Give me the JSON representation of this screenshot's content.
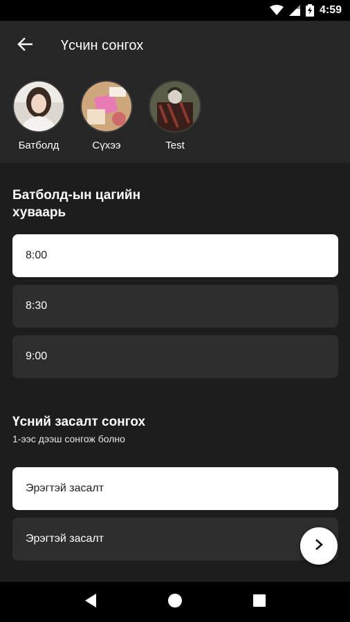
{
  "status_bar": {
    "time": "4:59",
    "icons": [
      "wifi-icon",
      "cellular-signal-icon",
      "battery-icon"
    ]
  },
  "app_bar": {
    "back_icon": "arrow-left-icon",
    "title": "Үсчин сонгох"
  },
  "stylists": [
    {
      "name": "Батболд"
    },
    {
      "name": "Сүхээ"
    },
    {
      "name": "Test"
    }
  ],
  "schedule": {
    "title_line1": "Батболд-ын цагийн",
    "title_line2": "хуваарь",
    "times": [
      {
        "label": "8:00",
        "selected": true
      },
      {
        "label": "8:30",
        "selected": false
      },
      {
        "label": "9:00",
        "selected": false
      }
    ]
  },
  "haircut": {
    "title": "Үсний засалт сонгох",
    "subtitle": "1-ээс дээш сонгож болно",
    "options": [
      {
        "label": "Эрэгтэй засалт",
        "selected": true
      },
      {
        "label": "Эрэгтэй засалт",
        "selected": false
      }
    ]
  },
  "fab": {
    "icon": "chevron-right-icon"
  },
  "nav_bar": {
    "icons": [
      "back-triangle-icon",
      "home-circle-icon",
      "recents-square-icon"
    ]
  },
  "colors": {
    "app_bar": "#262626",
    "content_bg": "#1d1d1d",
    "option_bg": "#2e2e2e",
    "selected_bg": "#ffffff"
  }
}
